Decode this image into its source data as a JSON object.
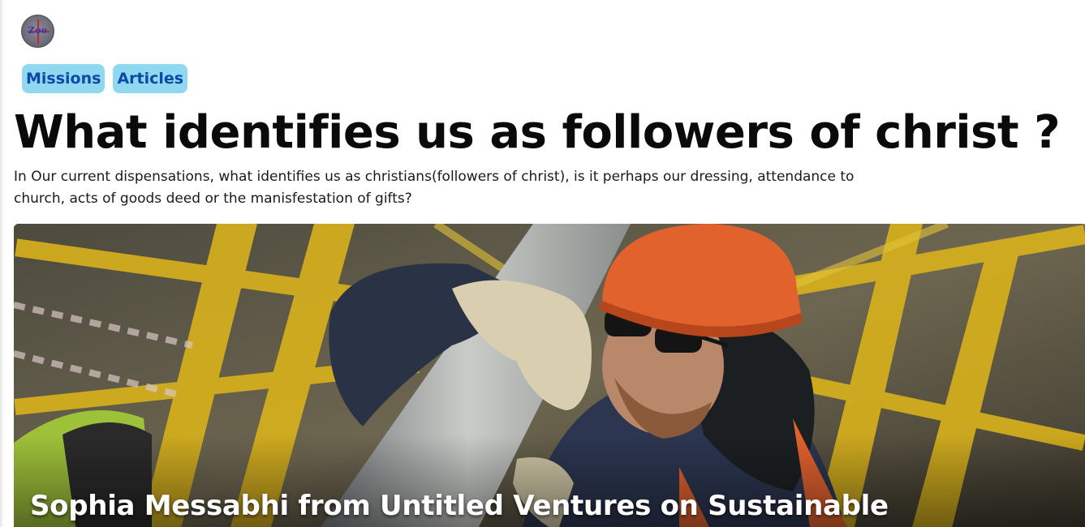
{
  "avatar": {
    "logo_text": "Zoe"
  },
  "tags": [
    {
      "label": "Missions"
    },
    {
      "label": "Articles"
    }
  ],
  "article": {
    "title": "What identifies us as followers of christ ?",
    "summary": "In Our current dispensations, what identifies us as christians(followers of christ), is it perhaps our dressing, attendance to church, acts of goods deed or the manisfestation of gifts?",
    "hero_caption": "Sophia Messabhi from Untitled Ventures on Sustainable"
  },
  "colors": {
    "tag_bg": "#8fd8f0",
    "tag_text": "#0b4aa6",
    "title": "#0a0a0a",
    "hard_hat": "#e2622e",
    "crane_yellow": "#d9b21c"
  }
}
